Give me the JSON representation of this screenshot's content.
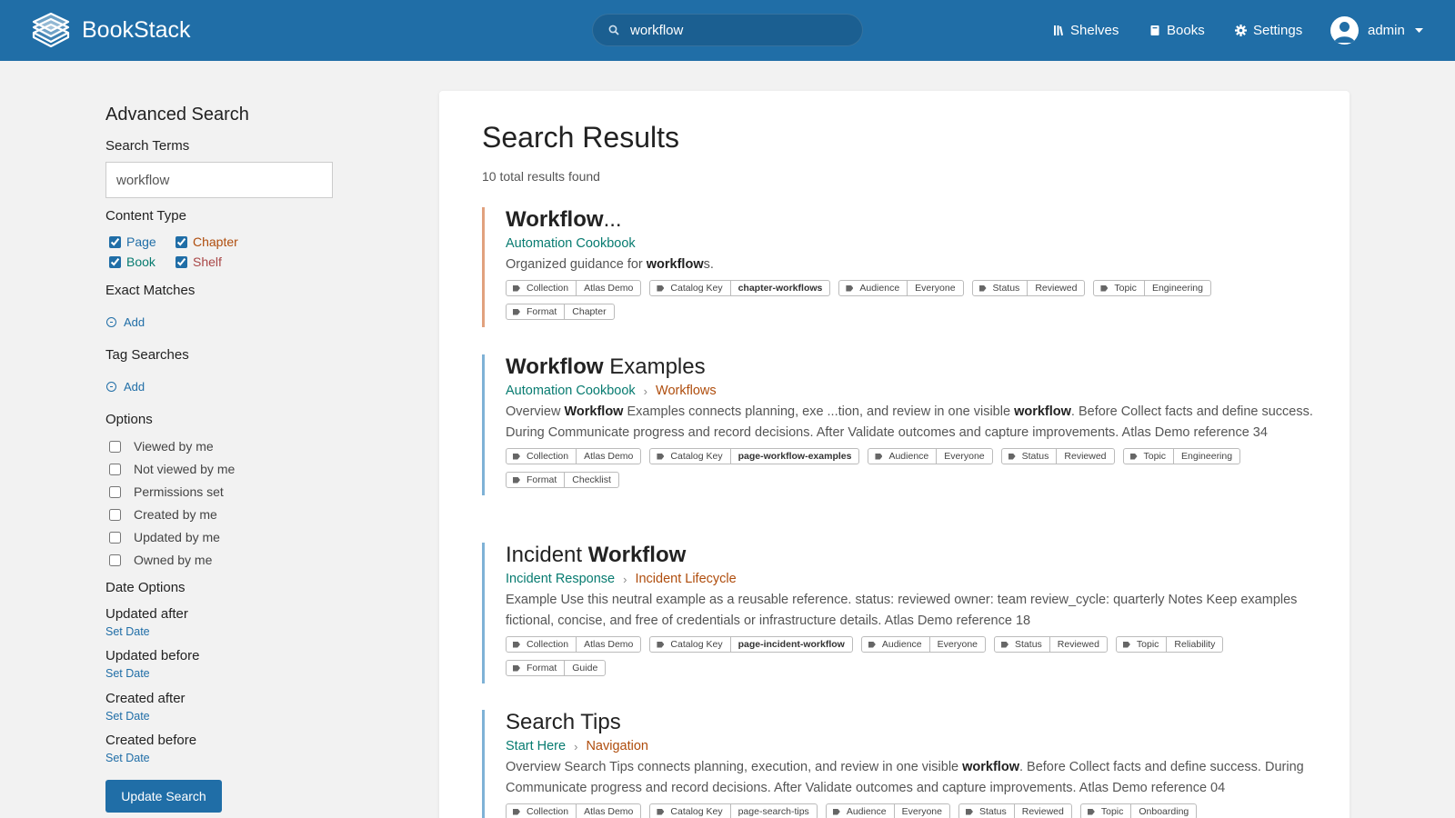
{
  "app": {
    "name": "BookStack"
  },
  "header": {
    "search_value": "workflow",
    "nav": {
      "shelves": "Shelves",
      "books": "Books",
      "settings": "Settings"
    },
    "user": "admin"
  },
  "sidebar": {
    "title": "Advanced Search",
    "search_terms_label": "Search Terms",
    "search_terms_value": "workflow",
    "content_type_label": "Content Type",
    "content_types": {
      "page": "Page",
      "chapter": "Chapter",
      "book": "Book",
      "shelf": "Shelf"
    },
    "exact_matches_label": "Exact Matches",
    "tag_searches_label": "Tag Searches",
    "add_label": "Add",
    "options_label": "Options",
    "options": [
      "Viewed by me",
      "Not viewed by me",
      "Permissions set",
      "Created by me",
      "Updated by me",
      "Owned by me"
    ],
    "date_options_label": "Date Options",
    "date_options": [
      "Updated after",
      "Updated before",
      "Created after",
      "Created before"
    ],
    "set_date_label": "Set Date",
    "update_button": "Update Search"
  },
  "main": {
    "title": "Search Results",
    "count": "10 total results found",
    "results": [
      {
        "title_bold": "Workflow",
        "title_rest": "...",
        "book": "Automation Cookbook",
        "chapter": "",
        "bar_color": "#e1a17e",
        "excerpt": [
          {
            "t": "Organized guidance for "
          },
          {
            "b": "workflow"
          },
          {
            "t": "s."
          }
        ],
        "tags": [
          {
            "name": "Collection",
            "value": "Atlas Demo"
          },
          {
            "name": "Catalog Key",
            "value": "chapter-workflows",
            "bold": true
          },
          {
            "name": "Audience",
            "value": "Everyone"
          },
          {
            "name": "Status",
            "value": "Reviewed"
          },
          {
            "name": "Topic",
            "value": "Engineering"
          },
          {
            "name": "Format",
            "value": "Chapter"
          }
        ]
      },
      {
        "title_bold": "Workflow",
        "title_rest": " Examples",
        "book": "Automation Cookbook",
        "chapter": "Workflows",
        "bar_color": "#7fb2d6",
        "excerpt": [
          {
            "t": "Overview "
          },
          {
            "b": "Workflow"
          },
          {
            "t": " Examples connects planning, exe ...tion, and review in one visible "
          },
          {
            "b": "workflow"
          },
          {
            "t": ". Before Collect facts and define success. During Communicate progress and record decisions. After Validate outcomes and capture improvements. Atlas Demo reference 34"
          }
        ],
        "tags": [
          {
            "name": "Collection",
            "value": "Atlas Demo"
          },
          {
            "name": "Catalog Key",
            "value": "page-workflow-examples",
            "bold": true
          },
          {
            "name": "Audience",
            "value": "Everyone"
          },
          {
            "name": "Status",
            "value": "Reviewed"
          },
          {
            "name": "Topic",
            "value": "Engineering"
          },
          {
            "name": "Format",
            "value": "Checklist"
          }
        ]
      },
      {
        "title_pre": "Incident ",
        "title_bold": "Workflow",
        "title_rest": "",
        "book": "Incident Response",
        "chapter": "Incident Lifecycle",
        "bar_color": "#7fb2d6",
        "excerpt": [
          {
            "t": "Example Use this neutral example as a reusable reference. status: reviewed owner: team review_cycle: quarterly Notes Keep examples fictional, concise, and free of credentials or infrastructure details. Atlas Demo reference 18"
          }
        ],
        "tags": [
          {
            "name": "Collection",
            "value": "Atlas Demo"
          },
          {
            "name": "Catalog Key",
            "value": "page-incident-workflow",
            "bold": true
          },
          {
            "name": "Audience",
            "value": "Everyone"
          },
          {
            "name": "Status",
            "value": "Reviewed"
          },
          {
            "name": "Topic",
            "value": "Reliability"
          },
          {
            "name": "Format",
            "value": "Guide"
          }
        ]
      },
      {
        "title_pre": "Search Tips",
        "title_bold": "",
        "title_rest": "",
        "book": "Start Here",
        "chapter": "Navigation",
        "bar_color": "#7fb2d6",
        "excerpt": [
          {
            "t": "Overview Search Tips connects planning, execution, and review in one visible "
          },
          {
            "b": "workflow"
          },
          {
            "t": ". Before Collect facts and define success. During Communicate progress and record decisions. After Validate outcomes and capture improvements. Atlas Demo reference 04"
          }
        ],
        "tags": [
          {
            "name": "Collection",
            "value": "Atlas Demo"
          },
          {
            "name": "Catalog Key",
            "value": "page-search-tips"
          },
          {
            "name": "Audience",
            "value": "Everyone"
          },
          {
            "name": "Status",
            "value": "Reviewed"
          },
          {
            "name": "Topic",
            "value": "Onboarding"
          }
        ]
      }
    ]
  }
}
